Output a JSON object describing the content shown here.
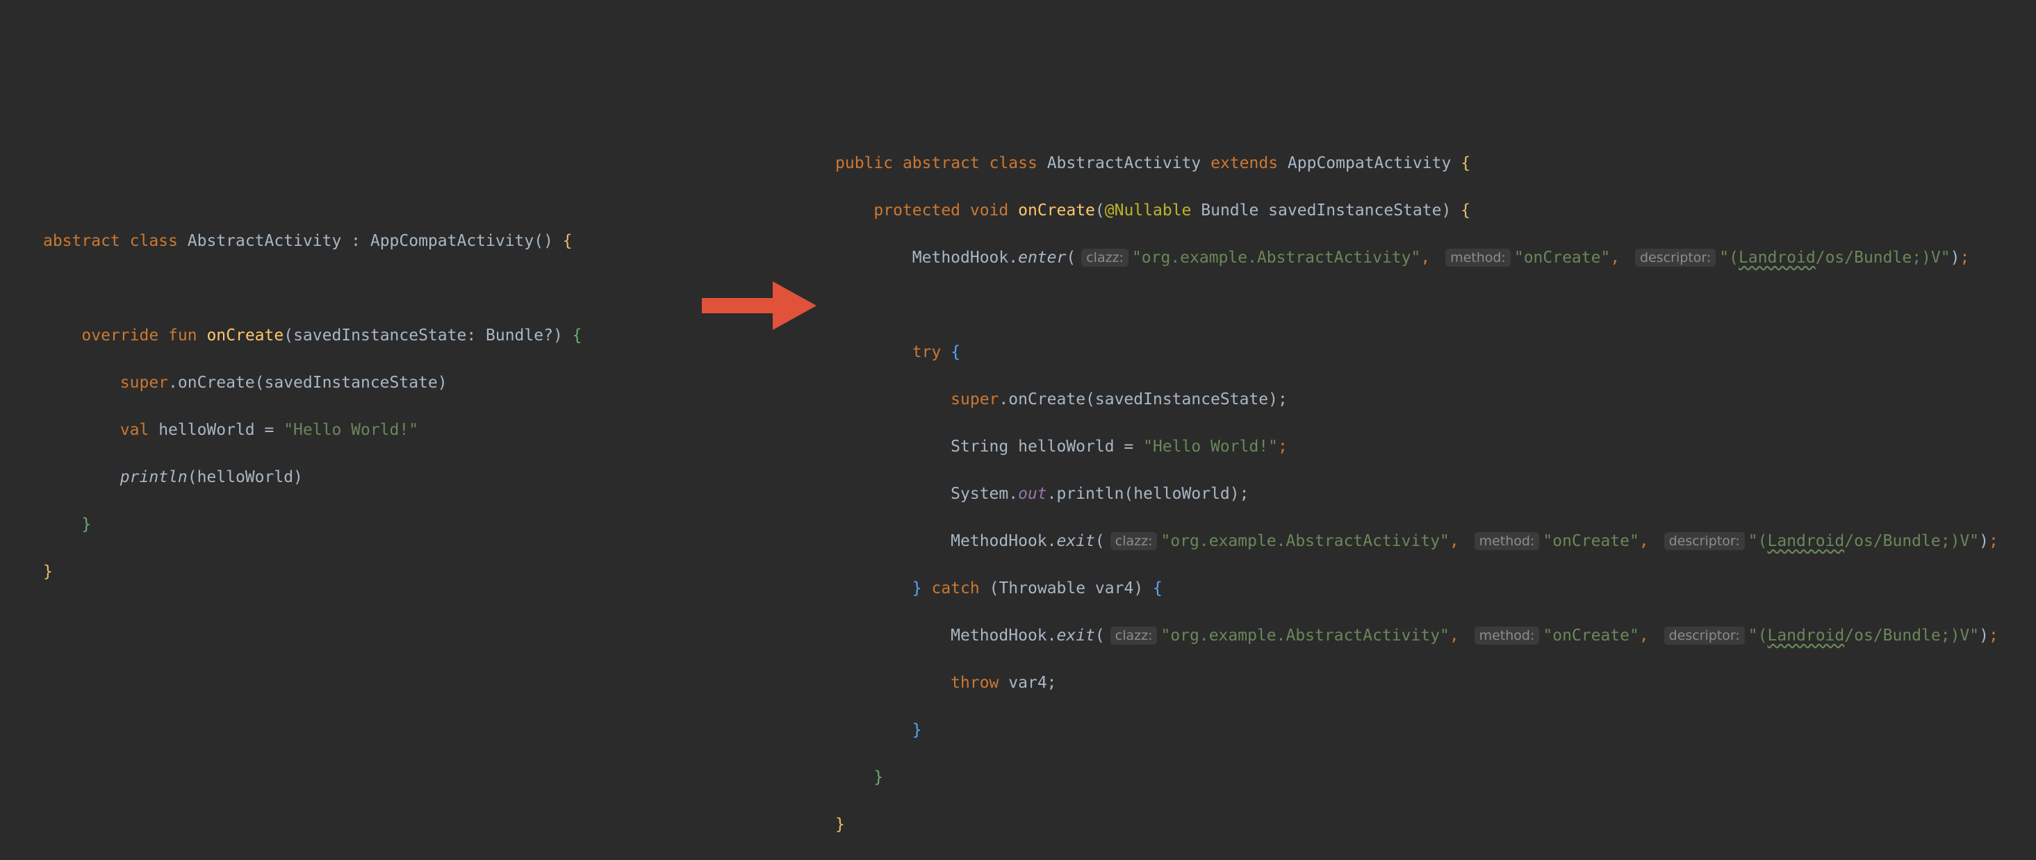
{
  "colors": {
    "background": "#2b2b2b",
    "keyword": "#cc7832",
    "function": "#ffc66d",
    "string": "#6a8759",
    "annotation": "#bbb529",
    "text": "#a9b7c6",
    "arrow": "#e0533a"
  },
  "arrow_icon": "right-arrow",
  "kotlin": {
    "l1_kw1": "abstract",
    "l1_kw2": "class",
    "l1_rest": "AbstractActivity : AppCompatActivity() ",
    "l1_brace": "{",
    "l3_kw1": "override",
    "l3_kw2": "fun",
    "l3_fn": "onCreate",
    "l3_params": "(savedInstanceState: Bundle?) ",
    "l3_brace": "{",
    "l4_kw": "super",
    "l4_rest": ".onCreate(savedInstanceState)",
    "l5_kw": "val",
    "l5_rest": "helloWorld = ",
    "l5_str": "\"Hello World!\"",
    "l6_fn": "println",
    "l6_rest": "(helloWorld)",
    "l7_brace": "}",
    "l8_brace": "}"
  },
  "java": {
    "l1_kw1": "public",
    "l1_kw2": "abstract",
    "l1_kw3": "class",
    "l1_name": "AbstractActivity",
    "l1_kw4": "extends",
    "l1_parent": "AppCompatActivity",
    "l1_brace": "{",
    "l2_kw1": "protected",
    "l2_kw2": "void",
    "l2_fn": "onCreate",
    "l2_ann": "@Nullable",
    "l2_rest": "Bundle savedInstanceState",
    "l2_brace": "{",
    "l3_call": "MethodHook.",
    "l3_method": "enter",
    "hint_clazz": "clazz:",
    "hint_method": "method:",
    "hint_descriptor": "descriptor:",
    "str_class": "\"org.example.AbstractActivity\"",
    "str_method": "\"onCreate\"",
    "str_desc_a": "\"(",
    "str_desc_b": "Landroid",
    "str_desc_c": "/os/Bundle;)V\"",
    "l5_kw": "try",
    "l5_brace": "{",
    "l6_kw": "super",
    "l6_rest": ".onCreate(savedInstanceState);",
    "l7_rest": "String helloWorld = ",
    "l7_str": "\"Hello World!\"",
    "l7_semi": ";",
    "l8_a": "System.",
    "l8_out": "out",
    "l8_b": ".println(helloWorld);",
    "l9_call": "MethodHook.",
    "l9_method": "exit",
    "l10_brace": "}",
    "l10_kw": "catch",
    "l10_rest": "(Throwable var4) ",
    "l10_brace2": "{",
    "l11_call": "MethodHook.",
    "l11_method": "exit",
    "l12_kw": "throw",
    "l12_rest": "var4;",
    "l13_brace": "}",
    "l14_brace": "}",
    "l15_brace": "}"
  }
}
